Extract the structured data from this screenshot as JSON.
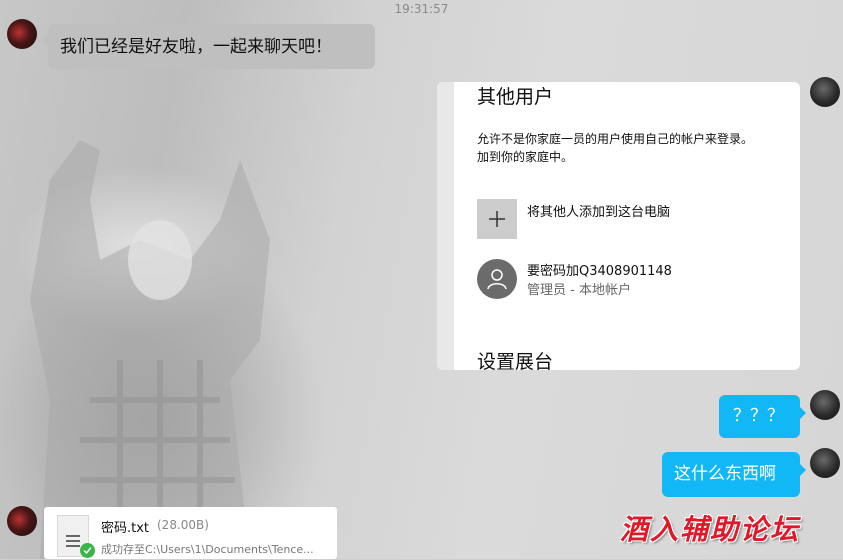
{
  "chat": {
    "timestamp": "19:31:57",
    "messages": [
      {
        "side": "left",
        "text": "我们已经是好友啦，一起来聊天吧！"
      },
      {
        "side": "right",
        "text": "？？？"
      },
      {
        "side": "right",
        "text": "这什么东西啊"
      }
    ],
    "colors": {
      "sent_bubble": "#12b7f5",
      "received_bubble": "#bfbfbf"
    }
  },
  "screenshot_card": {
    "title": "其他用户",
    "description_line1": "允许不是你家庭一员的用户使用自己的帐户来登录。",
    "description_line2": "加到你的家庭中。",
    "add_label": "将其他人添加到这台电脑",
    "user_name": "要密码加Q3408901148",
    "user_role": "管理员 - 本地帐户",
    "section2_title": "设置展台"
  },
  "file_message": {
    "name": "密码.txt",
    "size": "(28.00B)",
    "status": "成功存至C:\\Users\\1\\Documents\\Tence..."
  },
  "watermark": "酒入辅助论坛"
}
